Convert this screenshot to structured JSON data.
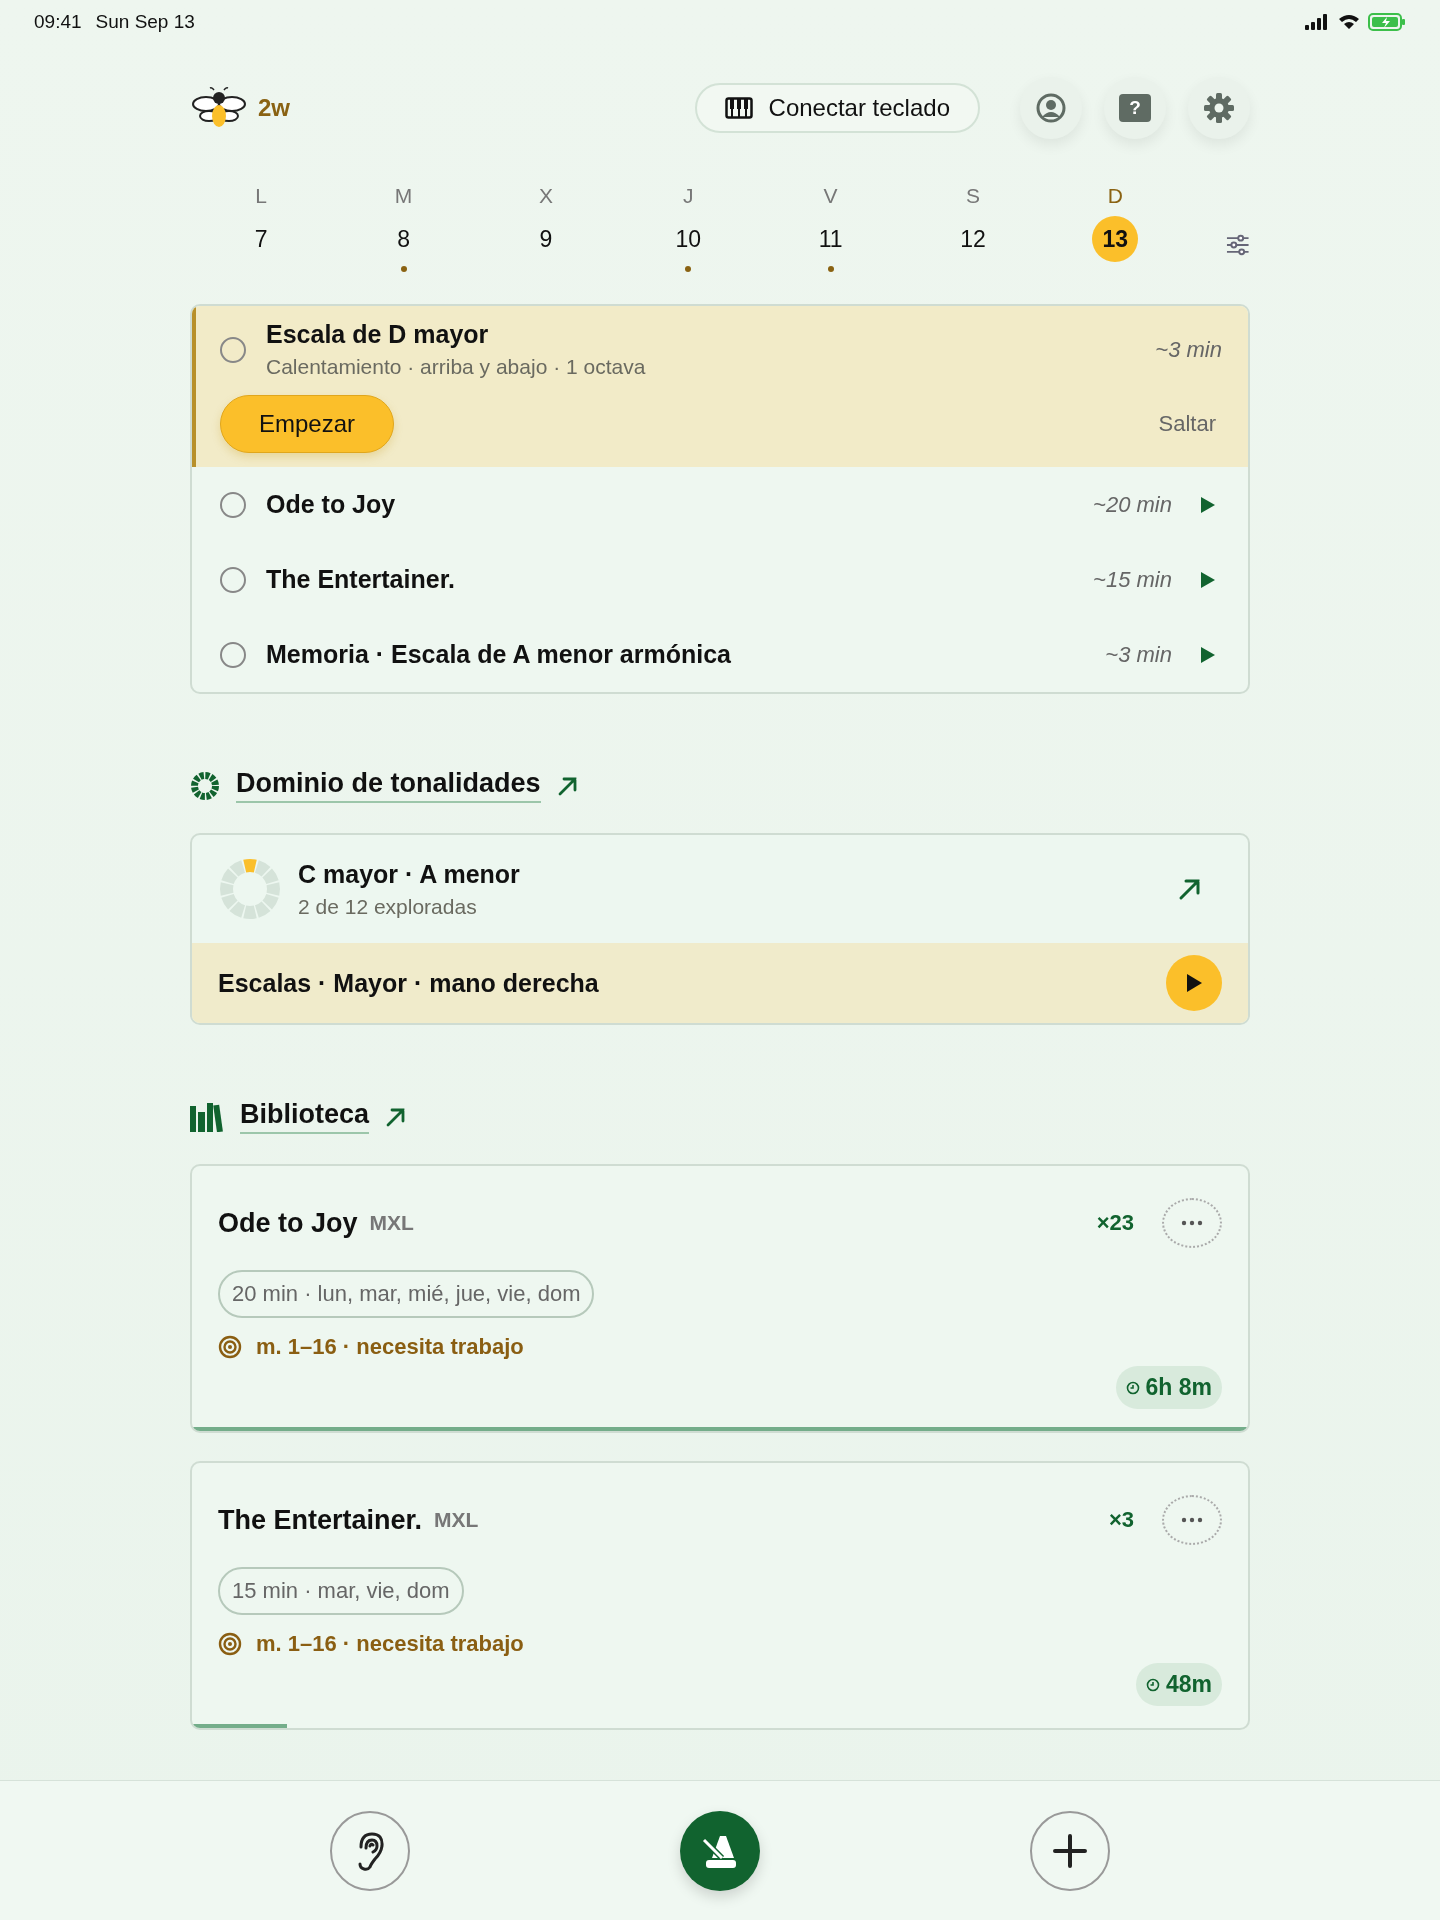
{
  "status_bar": {
    "time": "09:41",
    "date": "Sun Sep 13"
  },
  "header": {
    "streak": "2w",
    "keyboard_button": "Conectar teclado",
    "help_glyph": "?"
  },
  "week": [
    {
      "letter": "L",
      "day": "7",
      "selected": false,
      "has_session": false
    },
    {
      "letter": "M",
      "day": "8",
      "selected": false,
      "has_session": true
    },
    {
      "letter": "X",
      "day": "9",
      "selected": false,
      "has_session": false
    },
    {
      "letter": "J",
      "day": "10",
      "selected": false,
      "has_session": true
    },
    {
      "letter": "V",
      "day": "11",
      "selected": false,
      "has_session": true
    },
    {
      "letter": "S",
      "day": "12",
      "selected": false,
      "has_session": false
    },
    {
      "letter": "D",
      "day": "13",
      "selected": true,
      "has_session": false
    }
  ],
  "tasks": [
    {
      "kind": "current",
      "title": "Escala de D mayor",
      "subtitle": "Calentamiento · arriba y abajo · 1 octava",
      "duration": "~3 min",
      "checked": false,
      "start_button": "Empezar",
      "skip_button": "Saltar"
    },
    {
      "kind": "item",
      "title": "Ode to Joy",
      "duration": "~20 min",
      "checked": false
    },
    {
      "kind": "item",
      "title": "The Entertainer.",
      "duration": "~15 min",
      "checked": false
    },
    {
      "kind": "item",
      "title": "Memoria · Escala de A menor armónica",
      "duration": "~3 min",
      "checked": false
    }
  ],
  "key_mastery": {
    "heading": "Dominio de tonalidades",
    "key_title": "C mayor · A menor",
    "key_progress": "2 de 12 exploradas",
    "level": 0.0833,
    "exercise": "Escalas · Mayor · mano derecha"
  },
  "library": {
    "heading": "Biblioteca",
    "items": [
      {
        "title": "Ode to Joy",
        "format": "MXL",
        "count": "×23",
        "schedule": "20 min · lun, mar, mié, jue, vie, dom",
        "focus": "m. 1–16 · necesita trabajo",
        "time": "6h 8m",
        "level": 1
      },
      {
        "title": "The Entertainer.",
        "format": "MXL",
        "count": "×3",
        "schedule": "15 min · mar, vie, dom",
        "focus": "m. 1–16 · necesita trabajo",
        "time": "48m",
        "level": 0.09
      }
    ]
  }
}
